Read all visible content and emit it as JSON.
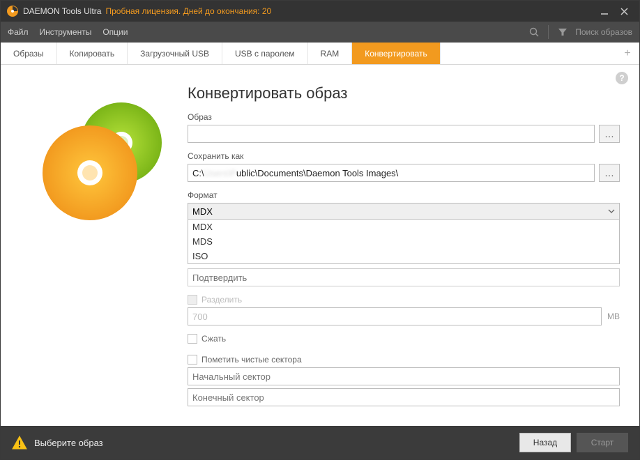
{
  "titlebar": {
    "app_name": "DAEMON Tools Ultra",
    "trial_text": "Пробная лицензия. Дней до окончания: 20"
  },
  "menubar": {
    "items": [
      "Файл",
      "Инструменты",
      "Опции"
    ],
    "search_placeholder": "Поиск образов"
  },
  "tabs": {
    "items": [
      {
        "label": "Образы",
        "active": false
      },
      {
        "label": "Копировать",
        "active": false
      },
      {
        "label": "Загрузочный USB",
        "active": false
      },
      {
        "label": "USB с паролем",
        "active": false
      },
      {
        "label": "RAM",
        "active": false
      },
      {
        "label": "Конвертировать",
        "active": true
      }
    ]
  },
  "form": {
    "heading": "Конвертировать образ",
    "image_label": "Образ",
    "image_value": "",
    "save_as_label": "Сохранить как",
    "save_as_value_prefix": "C:\\",
    "save_as_value_blur": "Users\\P",
    "save_as_value_suffix": "ublic\\Documents\\Daemon Tools Images\\",
    "format_label": "Формат",
    "format_selected": "MDX",
    "format_options": [
      "MDX",
      "MDS",
      "ISO"
    ],
    "password_placeholder": "Подтвердить",
    "split_label": "Разделить",
    "split_value": "700",
    "split_unit": "MB",
    "compress_label": "Сжать",
    "mark_sectors_label": "Пометить чистые сектора",
    "start_sector_placeholder": "Начальный сектор",
    "end_sector_placeholder": "Конечный сектор"
  },
  "footer": {
    "message": "Выберите образ",
    "back_label": "Назад",
    "start_label": "Старт"
  }
}
